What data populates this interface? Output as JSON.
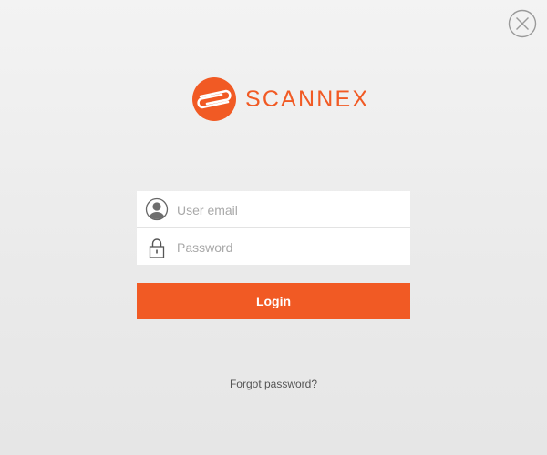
{
  "brand": {
    "name": "SCANNEX",
    "color": "#f15a24"
  },
  "window": {
    "close_icon": "close-circle-icon"
  },
  "form": {
    "email": {
      "placeholder": "User email",
      "value": "",
      "icon": "user-icon"
    },
    "password": {
      "placeholder": "Password",
      "value": "",
      "icon": "lock-icon"
    },
    "login_label": "Login",
    "forgot_label": "Forgot password?"
  },
  "colors": {
    "accent": "#f15a24",
    "background": "#ececec",
    "link_text": "#555555"
  }
}
